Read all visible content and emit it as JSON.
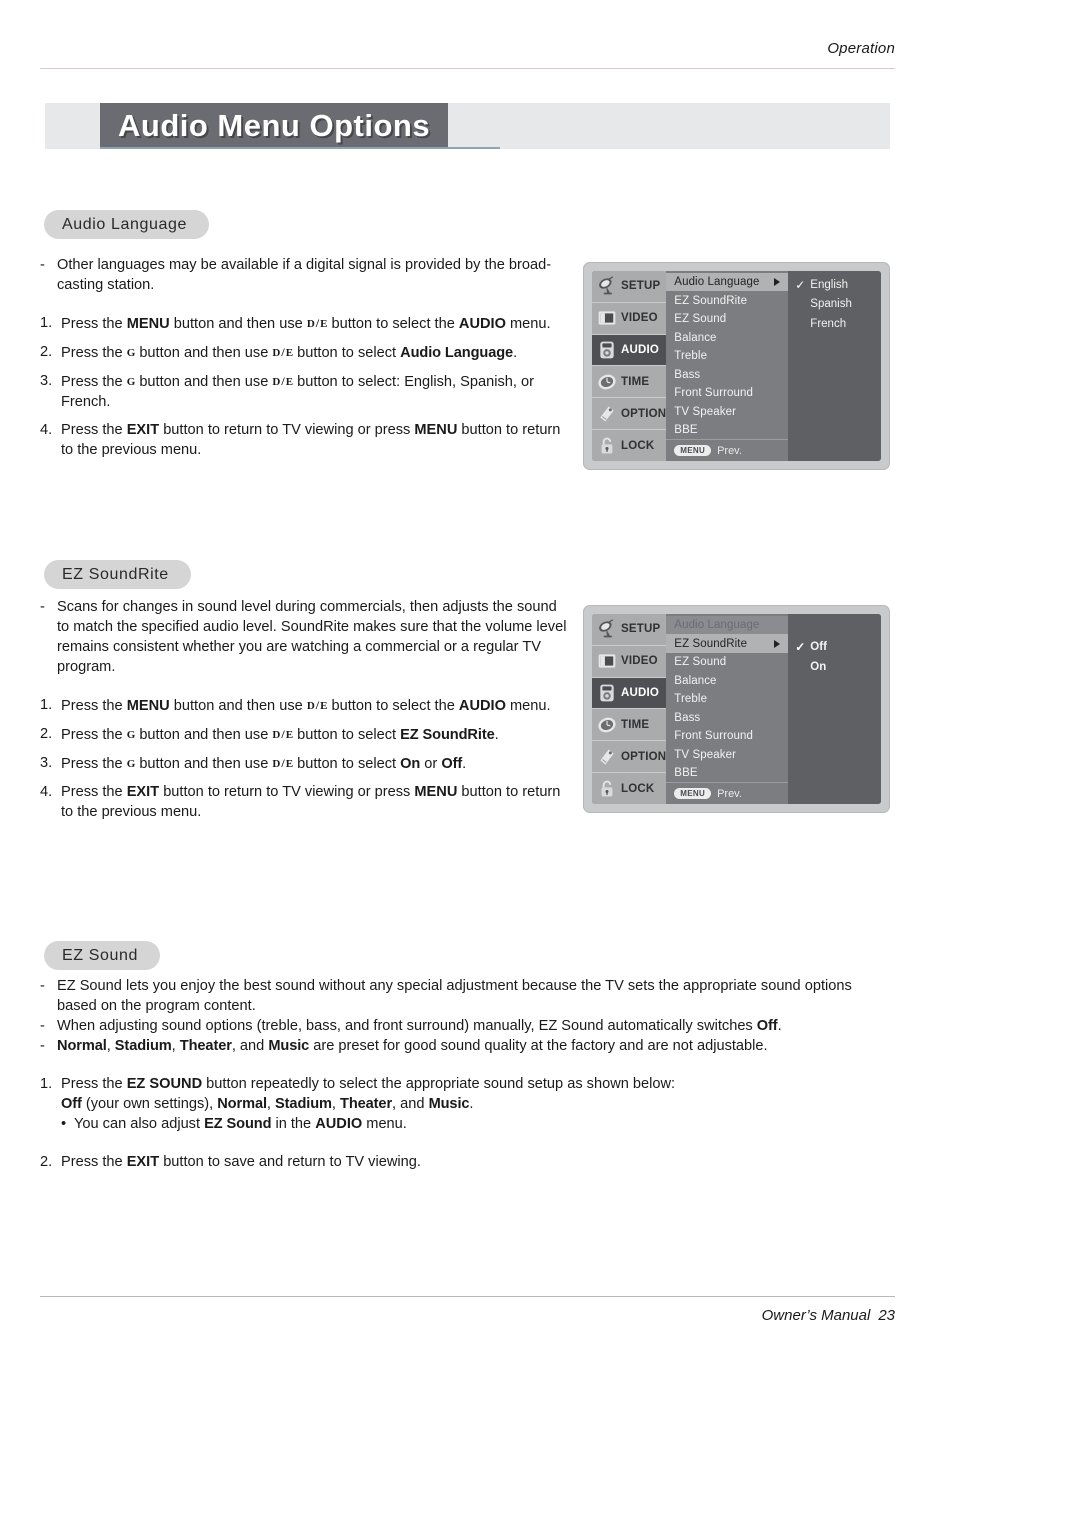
{
  "header": {
    "kicker": "Operation"
  },
  "title": {
    "text": "Audio Menu Options"
  },
  "sections": {
    "audio_language": {
      "pill": "Audio Language",
      "bullet1_pre": "Other languages may be available if a digital signal is provided by the broad-casting station.",
      "step1_a": "Press the ",
      "step1_b": "MENU",
      "step1_c": " button and then use ",
      "step1_d": " button to select the ",
      "step1_e": "AUDIO",
      "step1_f": " menu.",
      "step2_a": "Press the ",
      "step2_c": " button and then use ",
      "step2_d": " button to select ",
      "step2_e": "Audio Language",
      "step2_f": ".",
      "step3_a": "Press the ",
      "step3_c": " button and then use ",
      "step3_d": " button to select: English, Spanish, or French.",
      "step4_a": "Press the ",
      "step4_b": "EXIT",
      "step4_c": " button to return to TV viewing or press ",
      "step4_d": "MENU",
      "step4_e": " button to return to the previous menu."
    },
    "ez_soundrite": {
      "pill": "EZ SoundRite",
      "bullet1": "Scans for changes in sound level during commercials, then adjusts the sound to match the specified audio level. SoundRite makes sure that the volume level remains consistent whether you are watching a commercial or a regular TV program.",
      "step1_a": "Press the ",
      "step1_b": "MENU",
      "step1_c": " button and then use ",
      "step1_d": " button to select the ",
      "step1_e": "AUDIO",
      "step1_f": " menu.",
      "step2_a": "Press the ",
      "step2_c": " button and then use ",
      "step2_d": " button to select ",
      "step2_e": "EZ SoundRite",
      "step2_f": ".",
      "step3_a": "Press the ",
      "step3_c": " button and then use ",
      "step3_d": " button to select ",
      "step3_e": "On",
      "step3_f": " or ",
      "step3_g": "Off",
      "step3_h": ".",
      "step4_a": "Press the ",
      "step4_b": "EXIT",
      "step4_c": " button to return to TV viewing or press ",
      "step4_d": "MENU",
      "step4_e": " button to return to the previous menu."
    },
    "ez_sound": {
      "pill": "EZ Sound",
      "bullet1": "EZ Sound lets you enjoy the best sound without any special adjustment because the TV sets the appropriate sound options based on the program content.",
      "bullet2_a": "When adjusting sound options (treble, bass, and front surround) manually, EZ Sound automatically switches ",
      "bullet2_b": "Off",
      "bullet2_c": ".",
      "bullet3_a": "Normal",
      "bullet3_b": ", ",
      "bullet3_c": "Stadium",
      "bullet3_d": ", ",
      "bullet3_e": "Theater",
      "bullet3_f": ", and ",
      "bullet3_g": "Music",
      "bullet3_h": " are preset for good sound quality at the factory and are not adjustable.",
      "step1_a": "Press the ",
      "step1_b": "EZ SOUND",
      "step1_c": " button repeatedly to select the appropriate sound setup as shown below:",
      "step1_line2_a": "Off",
      "step1_line2_b": " (your own settings), ",
      "step1_line2_c": "Normal",
      "step1_line2_d": ", ",
      "step1_line2_e": "Stadium",
      "step1_line2_f": ", ",
      "step1_line2_g": "Theater",
      "step1_line2_h": ", and ",
      "step1_line2_i": "Music",
      "step1_line2_j": ".",
      "step1_sub_a": "You can also adjust ",
      "step1_sub_b": "EZ Sound",
      "step1_sub_c": " in the ",
      "step1_sub_d": "AUDIO",
      "step1_sub_e": " menu.",
      "step2_a": "Press the ",
      "step2_b": "EXIT",
      "step2_c": " button to save and return to TV viewing."
    }
  },
  "keys": {
    "down": "D",
    "sep": "/",
    "up": "E",
    "right": "G"
  },
  "osd_menu_1": {
    "tabs": [
      {
        "label": "SETUP",
        "icon": "satellite-dish-icon",
        "active": false
      },
      {
        "label": "VIDEO",
        "icon": "monitor-icon",
        "active": false
      },
      {
        "label": "AUDIO",
        "icon": "speaker-icon",
        "active": true
      },
      {
        "label": "TIME",
        "icon": "clock-icon",
        "active": false
      },
      {
        "label": "OPTION",
        "icon": "remote-tag-icon",
        "active": false
      },
      {
        "label": "LOCK",
        "icon": "padlock-icon",
        "active": false
      }
    ],
    "items": [
      {
        "label": "Audio Language",
        "state": "selected"
      },
      {
        "label": "EZ SoundRite",
        "state": "normal"
      },
      {
        "label": "EZ Sound",
        "state": "normal"
      },
      {
        "label": "Balance",
        "state": "normal"
      },
      {
        "label": "Treble",
        "state": "normal"
      },
      {
        "label": "Bass",
        "state": "normal"
      },
      {
        "label": "Front Surround",
        "state": "normal"
      },
      {
        "label": "TV Speaker",
        "state": "normal"
      },
      {
        "label": "BBE",
        "state": "normal"
      }
    ],
    "values": [
      {
        "label": "English",
        "checked": true
      },
      {
        "label": "Spanish",
        "checked": false
      },
      {
        "label": "French",
        "checked": false
      }
    ],
    "prev": {
      "menu_key": "MENU",
      "label": "Prev."
    }
  },
  "osd_menu_2": {
    "tabs": [
      {
        "label": "SETUP",
        "icon": "satellite-dish-icon",
        "active": false
      },
      {
        "label": "VIDEO",
        "icon": "monitor-icon",
        "active": false
      },
      {
        "label": "AUDIO",
        "icon": "speaker-icon",
        "active": true
      },
      {
        "label": "TIME",
        "icon": "clock-icon",
        "active": false
      },
      {
        "label": "OPTION",
        "icon": "remote-tag-icon",
        "active": false
      },
      {
        "label": "LOCK",
        "icon": "padlock-icon",
        "active": false
      }
    ],
    "items": [
      {
        "label": "Audio Language",
        "state": "dimmed"
      },
      {
        "label": "EZ SoundRite",
        "state": "selected"
      },
      {
        "label": "EZ Sound",
        "state": "normal"
      },
      {
        "label": "Balance",
        "state": "normal"
      },
      {
        "label": "Treble",
        "state": "normal"
      },
      {
        "label": "Bass",
        "state": "normal"
      },
      {
        "label": "Front Surround",
        "state": "normal"
      },
      {
        "label": "TV Speaker",
        "state": "normal"
      },
      {
        "label": "BBE",
        "state": "normal"
      }
    ],
    "values": [
      {
        "label": "Off",
        "checked": true
      },
      {
        "label": "On",
        "checked": false
      }
    ],
    "prev": {
      "menu_key": "MENU",
      "label": "Prev."
    }
  },
  "footer": {
    "text": "Owner’s Manual",
    "page": "23"
  },
  "colors": {
    "title_box": "#6b6b72",
    "title_bar": "#e7e8ea",
    "pill": "#d5d5d5",
    "osd_frame": "#c9cacb",
    "osd_sidebar": "#a9abad",
    "osd_list": "#7b7d81",
    "osd_panel": "#5e6064",
    "osd_highlight": "#b0b2b4"
  }
}
